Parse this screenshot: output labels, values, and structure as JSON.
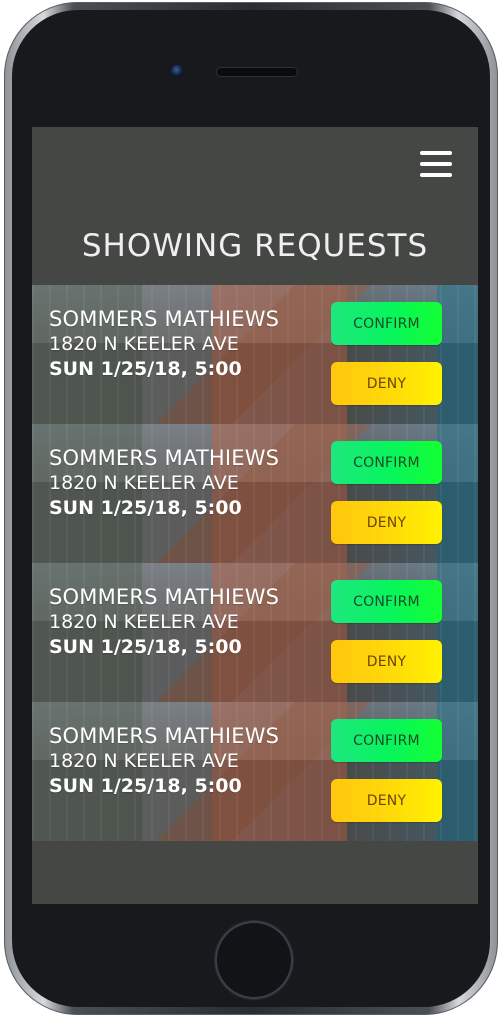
{
  "app": {
    "title": "SHOWING REQUESTS"
  },
  "menu": {
    "icon": "menu-icon"
  },
  "requests": [
    {
      "name": "SOMMERS MATHIEWS",
      "address": "1820 N KEELER AVE",
      "time": "SUN 1/25/18, 5:00",
      "confirm_label": "CONFIRM",
      "deny_label": "DENY"
    },
    {
      "name": "SOMMERS MATHIEWS",
      "address": "1820 N KEELER AVE",
      "time": "SUN 1/25/18, 5:00",
      "confirm_label": "CONFIRM",
      "deny_label": "DENY"
    },
    {
      "name": "SOMMERS MATHIEWS",
      "address": "1820 N KEELER AVE",
      "time": "SUN 1/25/18, 5:00",
      "confirm_label": "CONFIRM",
      "deny_label": "DENY"
    },
    {
      "name": "SOMMERS MATHIEWS",
      "address": "1820 N KEELER AVE",
      "time": "SUN 1/25/18, 5:00",
      "confirm_label": "CONFIRM",
      "deny_label": "DENY"
    }
  ],
  "colors": {
    "screen_background": "#454745",
    "confirm": "#07f65b",
    "deny": "#ffd80a",
    "text": "#ffffff"
  }
}
